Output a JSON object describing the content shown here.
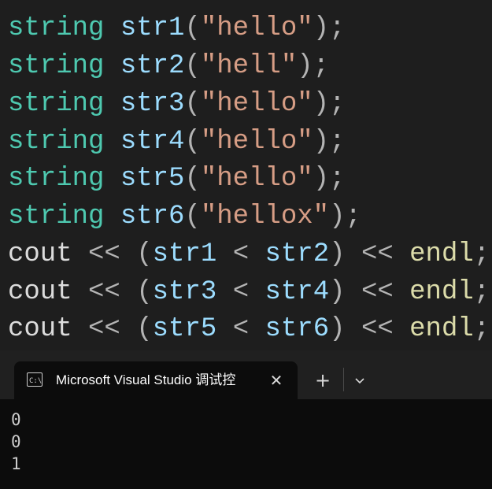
{
  "editor": {
    "lines": [
      {
        "type": "string",
        "name": "str1",
        "lit": "\"hello\""
      },
      {
        "type": "string",
        "name": "str2",
        "lit": "\"hell\""
      },
      {
        "type": "string",
        "name": "str3",
        "lit": "\"hello\""
      },
      {
        "type": "string",
        "name": "str4",
        "lit": "\"hello\""
      },
      {
        "type": "string",
        "name": "str5",
        "lit": "\"hello\""
      },
      {
        "type": "string",
        "name": "str6",
        "lit": "\"hellox\""
      }
    ],
    "couts": [
      {
        "cout": "cout",
        "a": "str1",
        "b": "str2",
        "endl": "endl"
      },
      {
        "cout": "cout",
        "a": "str3",
        "b": "str4",
        "endl": "endl"
      },
      {
        "cout": "cout",
        "a": "str5",
        "b": "str6",
        "endl": "endl"
      }
    ],
    "tokens": {
      "open": "(",
      "close": ");",
      "shift": "<<",
      "lt": "<",
      "lparen": "(",
      "rparen": ")",
      "semi": ";"
    }
  },
  "terminal": {
    "tab_title": "Microsoft Visual Studio 调试控",
    "close_glyph": "✕",
    "new_tab_glyph": "+",
    "output": [
      "0",
      "0",
      "1"
    ]
  },
  "colors": {
    "type": "#4ec9b0",
    "identifier": "#9cdcfe",
    "string": "#d69d85",
    "function": "#dcdcaa",
    "editor_bg": "#1e1e1e",
    "terminal_bg": "#0c0c0c"
  }
}
